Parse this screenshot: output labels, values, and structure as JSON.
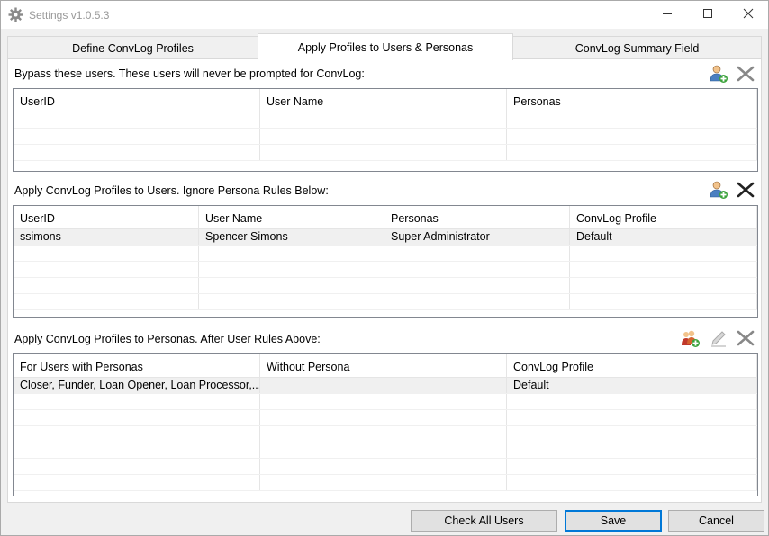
{
  "window": {
    "title": "Settings v1.0.5.3",
    "icons": {
      "app": "gear-icon",
      "min": "minimize-icon",
      "max": "maximize-icon",
      "close": "close-icon"
    }
  },
  "tabs": [
    {
      "label": "Define ConvLog Profiles"
    },
    {
      "label": "Apply Profiles to Users & Personas",
      "active": true
    },
    {
      "label": "ConvLog Summary Field"
    }
  ],
  "bypass": {
    "label": "Bypass these users.  These users will never be prompted for ConvLog:",
    "columns": [
      "UserID",
      "User Name",
      "Personas"
    ],
    "rows": []
  },
  "user_rules": {
    "label": "Apply ConvLog Profiles to Users.  Ignore Persona Rules Below:",
    "columns": [
      "UserID",
      "User Name",
      "Personas",
      "ConvLog Profile"
    ],
    "rows": [
      [
        "ssimons",
        "Spencer Simons",
        "Super Administrator",
        "Default"
      ]
    ]
  },
  "persona_rules": {
    "label": "Apply ConvLog Profiles to Personas.  After User Rules Above:",
    "columns": [
      "For Users with Personas",
      "Without Persona",
      "ConvLog Profile"
    ],
    "rows": [
      [
        "Closer, Funder, Loan Opener, Loan Processor,...",
        "",
        "Default"
      ]
    ]
  },
  "buttons": {
    "check_all": "Check All Users",
    "save": "Save",
    "cancel": "Cancel"
  }
}
